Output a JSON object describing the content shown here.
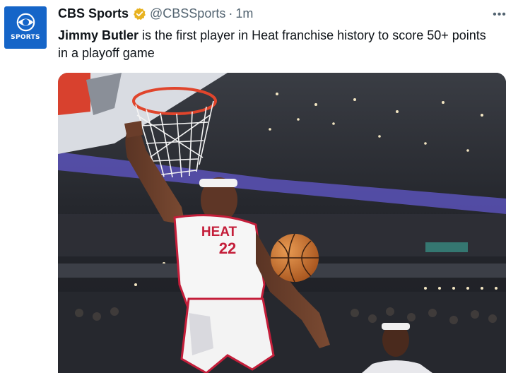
{
  "avatar": {
    "text": "SPORTS",
    "icon": "cbs-eye-logo",
    "color": "#1565c8"
  },
  "author": {
    "display_name": "CBS Sports",
    "handle": "@CBSSports",
    "separator": "·",
    "timestamp": "1m",
    "verified_icon": "gold-verified-badge",
    "verified_color": "#e8b21f"
  },
  "menu": {
    "more_label": "•••"
  },
  "tweet": {
    "text_bold": "Jimmy Butler",
    "text_rest": " is the first player in Heat franchise history to score 50+ points in a playoff game"
  },
  "media": {
    "jersey_team": "HEAT",
    "jersey_number": "22",
    "description_icon": "photo",
    "jersey_color": "#ffffff",
    "accent_color": "#c41e3a",
    "ball_color": "#d2772e"
  }
}
